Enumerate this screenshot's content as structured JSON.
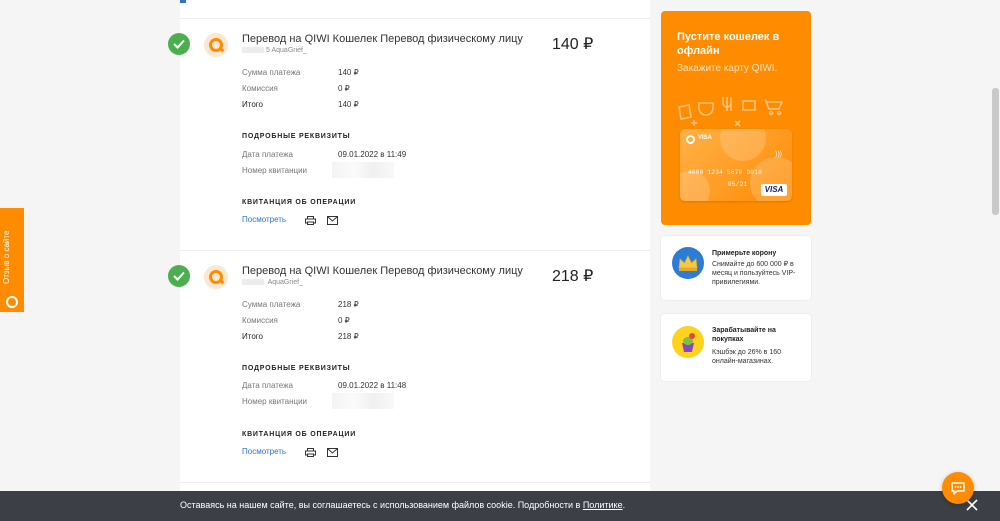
{
  "feedback": {
    "label": "Отзыв о сайте"
  },
  "transactions": [
    {
      "title": "Перевод на QIWI Кошелек Перевод физическому лицу",
      "account": "AquaGrief_",
      "account_prefix": "5",
      "amount": "140 ₽",
      "rows": [
        {
          "label": "Сумма платежа",
          "value": "140 ₽"
        },
        {
          "label": "Комиссия",
          "value": "0 ₽"
        },
        {
          "label": "Итого",
          "value": "140 ₽"
        }
      ],
      "details_header": "ПОДРОБНЫЕ РЕКВИЗИТЫ",
      "date_label": "Дата платежа",
      "date_value": "09.01.2022 в 11:49",
      "receipt_label": "Номер квитанции",
      "receipt_header": "КВИТАНЦИЯ ОБ ОПЕРАЦИИ",
      "view_label": "Посмотреть"
    },
    {
      "title": "Перевод на QIWI Кошелек Перевод физическому лицу",
      "account": "AquaGrief_",
      "account_prefix": "",
      "amount": "218 ₽",
      "rows": [
        {
          "label": "Сумма платежа",
          "value": "218 ₽"
        },
        {
          "label": "Комиссия",
          "value": "0 ₽"
        },
        {
          "label": "Итого",
          "value": "218 ₽"
        }
      ],
      "details_header": "ПОДРОБНЫЕ РЕКВИЗИТЫ",
      "date_label": "Дата платежа",
      "date_value": "09.01.2022 в 11:48",
      "receipt_label": "Номер квитанции",
      "receipt_header": "КВИТАНЦИЯ ОБ ОПЕРАЦИИ",
      "view_label": "Посмотреть"
    }
  ],
  "promo": {
    "title": "Пустите кошелек в офлайн",
    "subtitle": "Закажите карту QIWI.",
    "card_number": "4000 1234 5678 9010",
    "card_expiry": "05/21",
    "card_brand": "VISA"
  },
  "side_cards": [
    {
      "title": "Примерьте корону",
      "text": "Снимайте до 600 000 ₽ в месяц и пользуйтесь VIP-привилегиями."
    },
    {
      "title": "Зарабатывайте на покупках",
      "text": "Кэшбэк до 26% в 160 онлайн-магазинах."
    }
  ],
  "cookie": {
    "text": "Оставаясь на нашем сайте, вы соглашаетесь с использованием файлов cookie. Подробности в",
    "link": "Политике",
    "end": "."
  },
  "colors": {
    "accent": "#ff8c00",
    "success": "#4cae4f",
    "link": "#2f72c8",
    "bar": "#3c4046"
  }
}
